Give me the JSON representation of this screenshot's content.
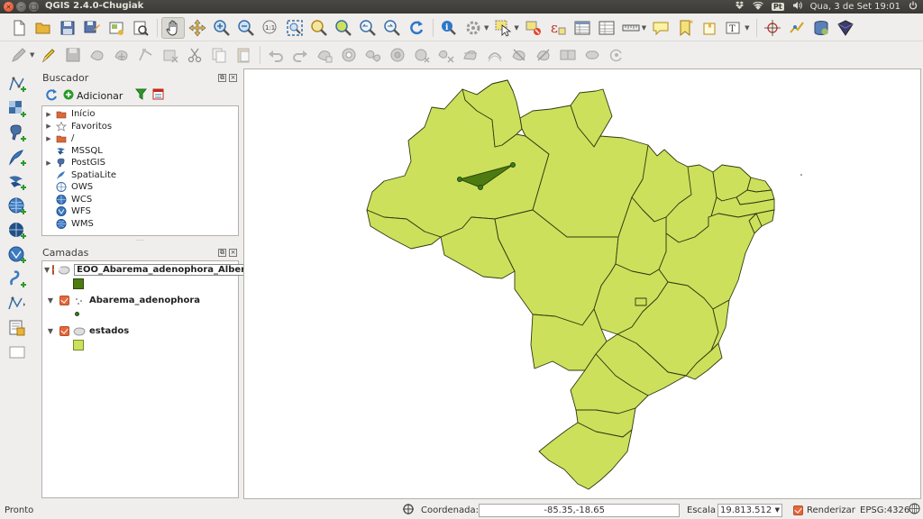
{
  "window": {
    "title": "QGIS 2.4.0-Chugiak",
    "close_glyph": "×",
    "min_glyph": "–",
    "max_glyph": "□"
  },
  "tray": {
    "keyboard": "Pt",
    "datetime": "Qua, 3 de Set 19:01"
  },
  "browser_panel": {
    "title": "Buscador",
    "add_label": "Adicionar",
    "items": [
      {
        "label": "Início",
        "icon": "home-folder-icon",
        "expandable": true
      },
      {
        "label": "Favoritos",
        "icon": "star-icon",
        "expandable": true
      },
      {
        "label": "/",
        "icon": "folder-icon",
        "expandable": true
      },
      {
        "label": "MSSQL",
        "icon": "mssql-icon",
        "expandable": false
      },
      {
        "label": "PostGIS",
        "icon": "postgis-icon",
        "expandable": true
      },
      {
        "label": "SpatiaLite",
        "icon": "spatialite-icon",
        "expandable": false
      },
      {
        "label": "OWS",
        "icon": "ows-globe-icon",
        "expandable": false
      },
      {
        "label": "WCS",
        "icon": "wcs-globe-icon",
        "expandable": false
      },
      {
        "label": "WFS",
        "icon": "wfs-globe-icon",
        "expandable": false
      },
      {
        "label": "WMS",
        "icon": "wms-globe-icon",
        "expandable": false
      }
    ]
  },
  "layers_panel": {
    "title": "Camadas",
    "layers": [
      {
        "name": "EOO_Abarema_adenophora_Albers",
        "symbol": "fill",
        "color": "#4e7a12",
        "checked": true
      },
      {
        "name": "Abarema_adenophora",
        "symbol": "point",
        "color": "#3e7d1f",
        "checked": true
      },
      {
        "name": "estados",
        "symbol": "fill",
        "color": "#cde05c",
        "checked": true
      }
    ]
  },
  "map": {
    "state_fill": "#cde05c",
    "state_stroke": "#2e3a10",
    "eoo_fill": "#4e7a12"
  },
  "status": {
    "message": "Pronto",
    "coord_label": "Coordenada:",
    "coord_value": "-85.35,-18.65",
    "scale_label": "Escala",
    "scale_value": "19.813.512",
    "render_label": "Renderizar",
    "epsg": "EPSG:4326"
  }
}
